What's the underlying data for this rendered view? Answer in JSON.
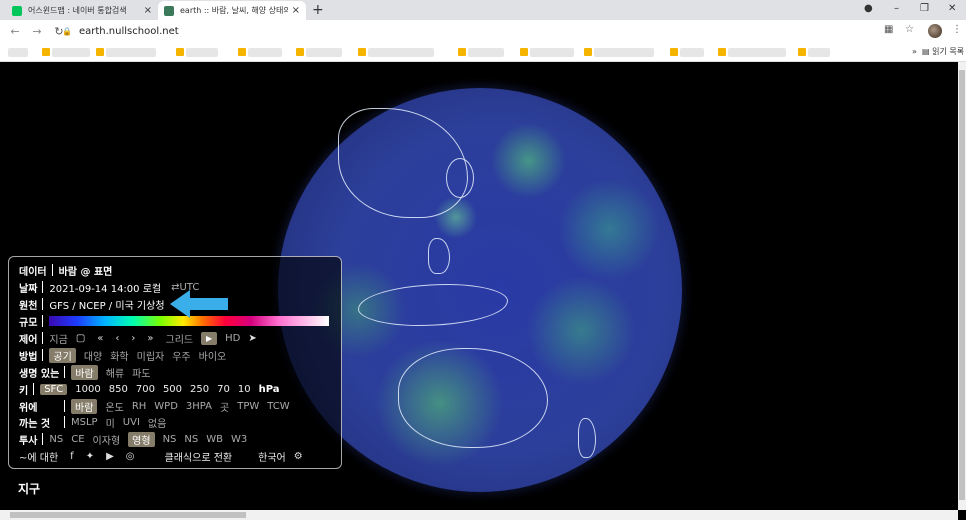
{
  "tabs": [
    {
      "title": "어스윈드맵 : 네이버 통합검색",
      "fav_color": "#03c75a"
    },
    {
      "title": "earth :: 바람, 날씨, 해양 상태의",
      "fav_color": "#3a7a5a"
    }
  ],
  "window_controls": {
    "minimize": "–",
    "restore": "❐",
    "close": "✕"
  },
  "address": {
    "url": "earth.nullschool.net"
  },
  "bookmarks": {
    "reading_list": "읽기 목록"
  },
  "panel": {
    "data": {
      "label": "데이터",
      "value": "바람 @ 표면"
    },
    "date": {
      "label": "날짜",
      "value": "2021-09-14 14:00 로컬",
      "utc": "⇄UTC"
    },
    "source": {
      "label": "원천",
      "value": "GFS / NCEP / 미국 기상청"
    },
    "scale": {
      "label": "규모"
    },
    "control": {
      "label": "제어",
      "now": "지금",
      "grid": "그리드",
      "hd": "HD"
    },
    "mode": {
      "label": "방법",
      "items": [
        "공기",
        "대양",
        "화학",
        "미립자",
        "우주",
        "바이오"
      ]
    },
    "animate": {
      "label": "생명 있는",
      "items": [
        "바람",
        "해류",
        "파도"
      ]
    },
    "height": {
      "label": "키",
      "items": [
        "SFC",
        "1000",
        "850",
        "700",
        "500",
        "250",
        "70",
        "10",
        "hPa"
      ]
    },
    "overlay": {
      "label1": "위에",
      "label2": "까는 것",
      "row1": [
        "바람",
        "온도",
        "RH",
        "WPD",
        "3HPA",
        "곳",
        "TPW",
        "TCW"
      ],
      "row2": [
        "MSLP",
        "미",
        "UVI",
        "없음"
      ]
    },
    "projection": {
      "label": "투사",
      "items": [
        "NS",
        "CE",
        "이자형",
        "영형",
        "NS",
        "NS",
        "WB",
        "W3"
      ]
    },
    "footer": {
      "about": "~에 대한",
      "classic": "클래식으로 전환",
      "lang": "한국어"
    }
  },
  "page": {
    "earth_label": "지구"
  },
  "colors": {
    "accent_selected": "#857d6a",
    "arrow": "#3aaee8"
  }
}
